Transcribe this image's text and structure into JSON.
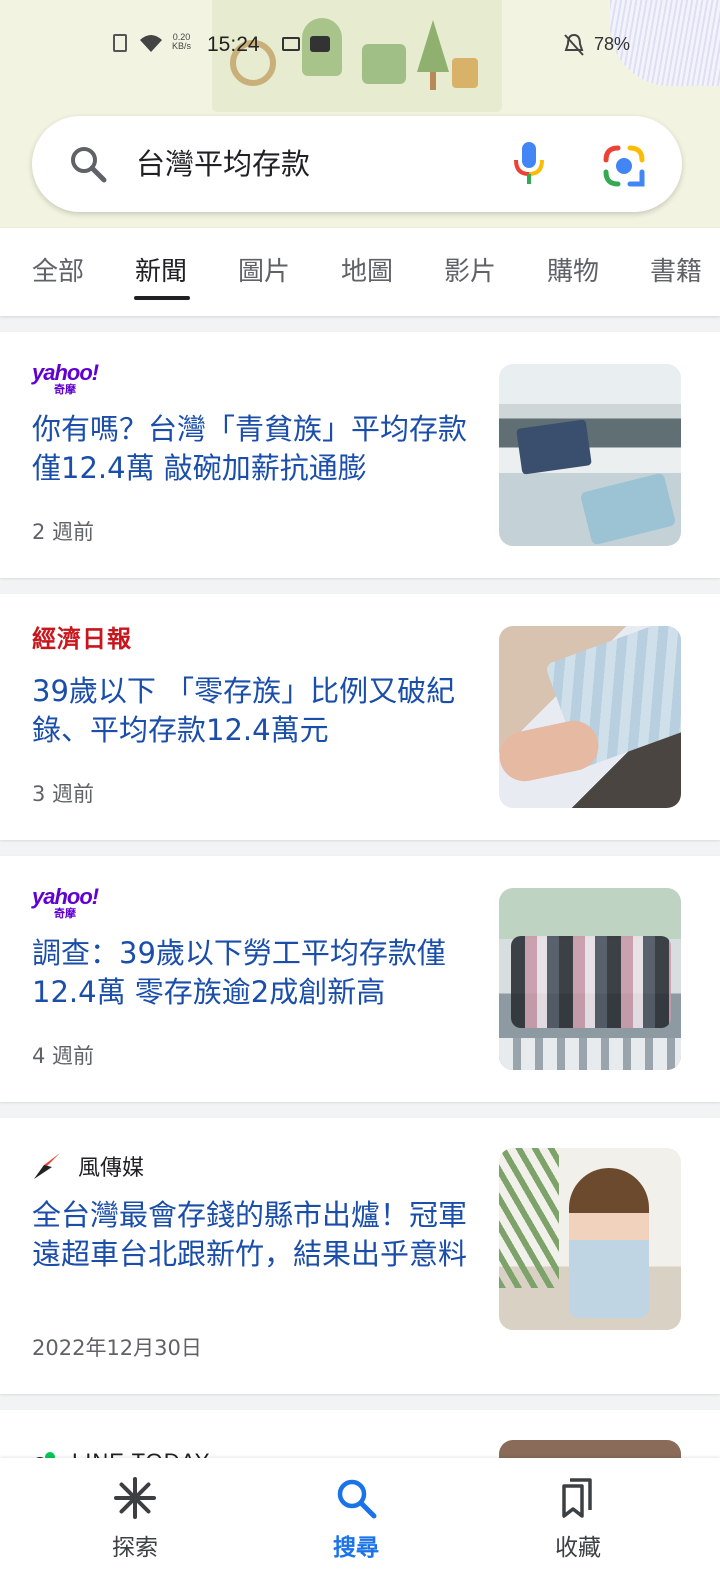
{
  "status_bar": {
    "speed": "0.20\nKB/s",
    "time": "15:24",
    "battery": "78%"
  },
  "search": {
    "query": "台灣平均存款"
  },
  "tabs": [
    {
      "label": "全部"
    },
    {
      "label": "新聞",
      "active": true
    },
    {
      "label": "圖片"
    },
    {
      "label": "地圖"
    },
    {
      "label": "影片"
    },
    {
      "label": "購物"
    },
    {
      "label": "書籍"
    }
  ],
  "cards": [
    {
      "source": "yahoo!",
      "source_sub": "奇摩",
      "headline": "你有嗎？台灣「青貧族」平均存款僅12.4萬 敲碗加薪抗通膨",
      "time": "2 週前"
    },
    {
      "source": "經濟日報",
      "headline": "39歲以下 「零存族」比例又破紀錄、平均存款12.4萬元",
      "time": "3 週前"
    },
    {
      "source": "yahoo!",
      "source_sub": "奇摩",
      "headline": "調查：39歲以下勞工平均存款僅12.4萬 零存族逾2成創新高",
      "time": "4 週前"
    },
    {
      "source": "風傳媒",
      "headline": "全台灣最會存錢的縣市出爐！冠軍遠超車台北跟新竹，結果出乎意料",
      "time": "2022年12月30日"
    },
    {
      "source": "LINE TODAY"
    }
  ],
  "bottom_nav": [
    {
      "label": "探索",
      "icon": "asterisk-icon"
    },
    {
      "label": "搜尋",
      "icon": "search-icon",
      "active": true
    },
    {
      "label": "收藏",
      "icon": "bookmarks-icon"
    }
  ],
  "colors": {
    "headline": "#1a4eaa",
    "accent": "#1a73e8",
    "yahoo": "#6001d2",
    "udn": "#c8161d"
  }
}
